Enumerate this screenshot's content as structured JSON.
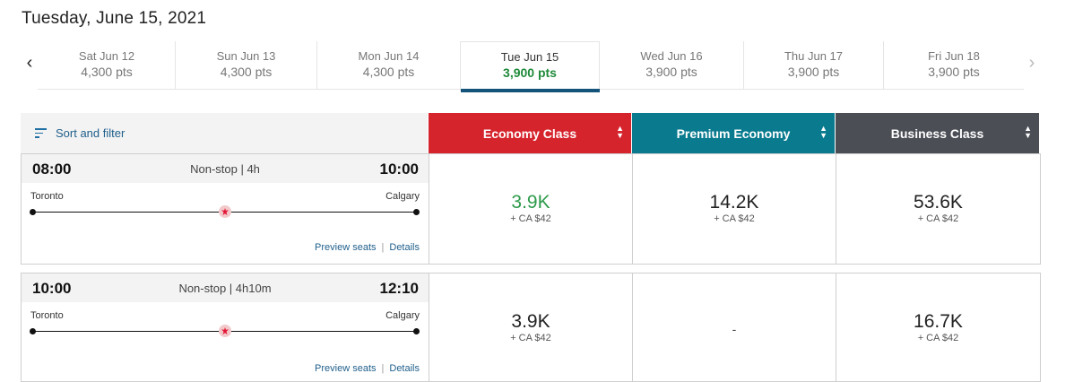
{
  "page": {
    "title": "Tuesday, June 15, 2021"
  },
  "dates": [
    {
      "day": "Sat Jun 12",
      "pts": "4,300 pts"
    },
    {
      "day": "Sun Jun 13",
      "pts": "4,300 pts"
    },
    {
      "day": "Mon Jun 14",
      "pts": "4,300 pts"
    },
    {
      "day": "Tue Jun 15",
      "pts": "3,900 pts"
    },
    {
      "day": "Wed Jun 16",
      "pts": "3,900 pts"
    },
    {
      "day": "Thu Jun 17",
      "pts": "3,900 pts"
    },
    {
      "day": "Fri Jun 18",
      "pts": "3,900 pts"
    }
  ],
  "nav": {
    "prev": "‹",
    "next": "›"
  },
  "sort": {
    "label": "Sort and filter"
  },
  "cabins": [
    {
      "label": "Economy Class",
      "color": "#d6242d"
    },
    {
      "label": "Premium Economy",
      "color": "#0a7b8f"
    },
    {
      "label": "Business Class",
      "color": "#4b4e55"
    }
  ],
  "flights": [
    {
      "dep": "08:00",
      "arr": "10:00",
      "duration": "Non-stop | 4h",
      "origin": "Toronto",
      "dest": "Calgary",
      "links": {
        "seats": "Preview seats",
        "sep": "|",
        "details": "Details"
      },
      "fares": [
        {
          "amount": "3.9K",
          "tax": "+ CA $42"
        },
        {
          "amount": "14.2K",
          "tax": "+ CA $42"
        },
        {
          "amount": "53.6K",
          "tax": "+ CA $42"
        }
      ]
    },
    {
      "dep": "10:00",
      "arr": "12:10",
      "duration": "Non-stop | 4h10m",
      "origin": "Toronto",
      "dest": "Calgary",
      "links": {
        "seats": "Preview seats",
        "sep": "|",
        "details": "Details"
      },
      "fares": [
        {
          "amount": "3.9K",
          "tax": "+ CA $42"
        },
        {
          "amount": "-",
          "tax": ""
        },
        {
          "amount": "16.7K",
          "tax": "+ CA $42"
        }
      ]
    }
  ],
  "colors": {
    "accent": "#14537a",
    "selected_price": "#1f8a3a",
    "lowest_fare": "#2e9a4b"
  }
}
